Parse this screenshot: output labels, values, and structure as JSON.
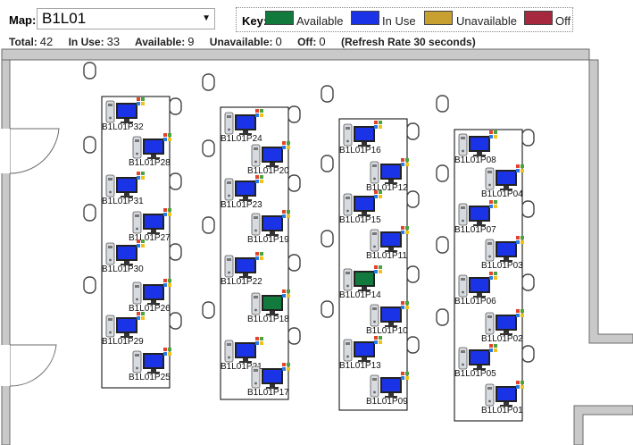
{
  "header": {
    "map_label": "Map:",
    "map_value": "B1L01",
    "key": {
      "label": "Key:",
      "items": [
        {
          "name": "Available",
          "color": "#117a3c"
        },
        {
          "name": "In Use",
          "color": "#1b33e6"
        },
        {
          "name": "Unavailable",
          "color": "#c8a032"
        },
        {
          "name": "Off",
          "color": "#a6283f"
        }
      ]
    }
  },
  "stats": {
    "total_label": "Total:",
    "total": "42",
    "inuse_label": "In Use:",
    "inuse": "33",
    "available_label": "Available:",
    "available": "9",
    "unavailable_label": "Unavailable:",
    "unavailable": "0",
    "off_label": "Off:",
    "off": "0",
    "refresh": "(Refresh Rate 30 seconds)"
  },
  "stations": [
    {
      "name": "B1L01P32",
      "status": "inuse"
    },
    {
      "name": "B1L01P28",
      "status": "inuse"
    },
    {
      "name": "B1L01P31",
      "status": "inuse"
    },
    {
      "name": "B1L01P27",
      "status": "inuse"
    },
    {
      "name": "B1L01P30",
      "status": "inuse"
    },
    {
      "name": "B1L01P26",
      "status": "inuse"
    },
    {
      "name": "B1L01P29",
      "status": "inuse"
    },
    {
      "name": "B1L01P25",
      "status": "inuse"
    },
    {
      "name": "B1L01P24",
      "status": "inuse"
    },
    {
      "name": "B1L01P20",
      "status": "inuse"
    },
    {
      "name": "B1L01P23",
      "status": "inuse"
    },
    {
      "name": "B1L01P19",
      "status": "inuse"
    },
    {
      "name": "B1L01P22",
      "status": "inuse"
    },
    {
      "name": "B1L01P18",
      "status": "available"
    },
    {
      "name": "B1L01P21",
      "status": "inuse"
    },
    {
      "name": "B1L01P17",
      "status": "inuse"
    },
    {
      "name": "B1L01P16",
      "status": "inuse"
    },
    {
      "name": "B1L01P12",
      "status": "inuse"
    },
    {
      "name": "B1L01P15",
      "status": "inuse"
    },
    {
      "name": "B1L01P11",
      "status": "inuse"
    },
    {
      "name": "B1L01P14",
      "status": "available"
    },
    {
      "name": "B1L01P10",
      "status": "inuse"
    },
    {
      "name": "B1L01P13",
      "status": "inuse"
    },
    {
      "name": "B1L01P09",
      "status": "inuse"
    },
    {
      "name": "B1L01P08",
      "status": "inuse"
    },
    {
      "name": "B1L01P04",
      "status": "inuse"
    },
    {
      "name": "B1L01P07",
      "status": "inuse"
    },
    {
      "name": "B1L01P03",
      "status": "inuse"
    },
    {
      "name": "B1L01P06",
      "status": "inuse"
    },
    {
      "name": "B1L01P02",
      "status": "inuse"
    },
    {
      "name": "B1L01P05",
      "status": "inuse"
    },
    {
      "name": "B1L01P01",
      "status": "inuse"
    }
  ]
}
